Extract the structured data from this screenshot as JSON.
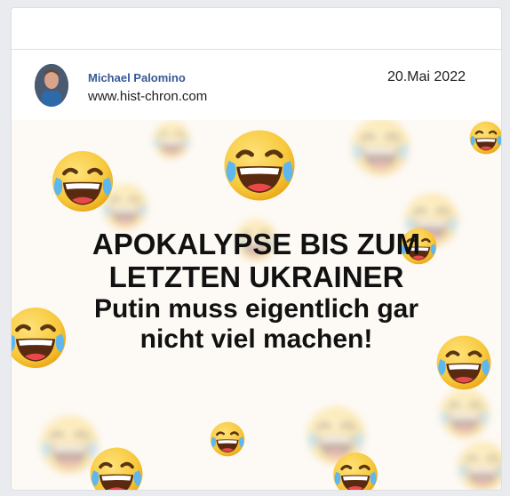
{
  "post": {
    "author_name": "Michael Palomino",
    "website": "www.hist-chron.com",
    "date": "20.Mai 2022"
  },
  "meme": {
    "headline_lines": [
      "APOKALYPSE BIS ZUM",
      "LETZTEN UKRAINER",
      "Putin muss eigentlich gar",
      "nicht viel machen!"
    ],
    "emoji_icon": "laughing-crying-emoji-icon"
  },
  "colors": {
    "author_link": "#385898",
    "meme_background": "#fdf9f4",
    "emoji_yellow": "#f7c83c"
  }
}
